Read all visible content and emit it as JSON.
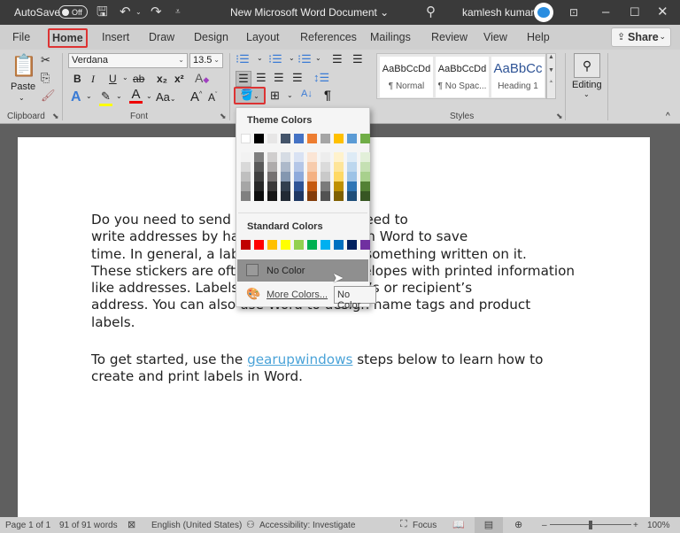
{
  "titlebar": {
    "autosave_label": "AutoSave",
    "autosave_state": "Off",
    "document_title": "New Microsoft Word Document",
    "user_name": "kamlesh kumar",
    "icons": [
      "save-icon",
      "undo-icon",
      "redo-icon",
      "customize-qat-icon",
      "search-icon",
      "ribbon-display-icon",
      "minimize-icon",
      "maximize-icon",
      "close-icon"
    ]
  },
  "tabs": [
    {
      "label": "File"
    },
    {
      "label": "Home",
      "active": true
    },
    {
      "label": "Insert"
    },
    {
      "label": "Draw"
    },
    {
      "label": "Design"
    },
    {
      "label": "Layout"
    },
    {
      "label": "References"
    },
    {
      "label": "Mailings"
    },
    {
      "label": "Review"
    },
    {
      "label": "View"
    },
    {
      "label": "Help"
    }
  ],
  "share_label": "Share",
  "ribbon": {
    "clipboard": {
      "label": "Clipboard",
      "paste": "Paste"
    },
    "font": {
      "label": "Font",
      "font_name": "Verdana",
      "font_size": "13.5",
      "buttons": {
        "bold": "B",
        "italic": "I",
        "underline": "U",
        "strike": "ab",
        "subscript": "x₂",
        "superscript": "x²",
        "case": "Aa",
        "grow": "A",
        "shrink": "A"
      }
    },
    "paragraph": {
      "sort": "A↓",
      "pilcrow": "¶"
    },
    "styles": {
      "label": "Styles",
      "items": [
        {
          "sample": "AaBbCcDd",
          "name": "¶ Normal"
        },
        {
          "sample": "AaBbCcDd",
          "name": "¶ No Spac..."
        },
        {
          "sample": "AaBbCc",
          "name": "Heading 1"
        }
      ]
    },
    "editing": {
      "label": "Editing"
    }
  },
  "shading_menu": {
    "theme_title": "Theme Colors",
    "theme_colors": [
      "#ffffff",
      "#000000",
      "#e7e6e6",
      "#44546a",
      "#4472c4",
      "#ed7d31",
      "#a5a5a5",
      "#ffc000",
      "#5b9bd5",
      "#70ad47"
    ],
    "theme_shades": [
      [
        "#f2f2f2",
        "#d9d9d9",
        "#bfbfbf",
        "#a6a6a6",
        "#808080"
      ],
      [
        "#7f7f7f",
        "#595959",
        "#3f3f3f",
        "#262626",
        "#0d0d0d"
      ],
      [
        "#d0cece",
        "#aeabab",
        "#757171",
        "#3a3838",
        "#171616"
      ],
      [
        "#d6dce4",
        "#adb9ca",
        "#8497b0",
        "#323f4f",
        "#222a35"
      ],
      [
        "#d9e2f3",
        "#b4c6e7",
        "#8eaadb",
        "#2f5496",
        "#1f3864"
      ],
      [
        "#fbe5d5",
        "#f7cbac",
        "#f4b183",
        "#c55a11",
        "#833c0b"
      ],
      [
        "#ededed",
        "#dbdbdb",
        "#c9c9c9",
        "#7b7b7b",
        "#525252"
      ],
      [
        "#fff2cc",
        "#fee599",
        "#ffd965",
        "#bf9000",
        "#7f6000"
      ],
      [
        "#deebf6",
        "#bdd7ee",
        "#9dc3e6",
        "#2e75b5",
        "#1e4e79"
      ],
      [
        "#e2efd9",
        "#c5e0b3",
        "#a8d08d",
        "#538135",
        "#375623"
      ]
    ],
    "standard_title": "Standard Colors",
    "standard_colors": [
      "#c00000",
      "#ff0000",
      "#ffc000",
      "#ffff00",
      "#92d050",
      "#00b050",
      "#00b0f0",
      "#0070c0",
      "#002060",
      "#7030a0"
    ],
    "no_color": "No Color",
    "more_colors": "More Colors..."
  },
  "tooltip": "No Color",
  "document": {
    "para1": "Do you need to send letters? You don’t need to write addresses by hand. Create a label in Word to save time. In general, a label is a sticker with something written on it. These stickers are often attached to envelopes with printed information like addresses. Labels include the sender’s or recipient’s address. You can also use Word to design name tags and product labels.",
    "para1_lines": [
      "Do you need to send letters? You don’t need to",
      "write addresses by hand. Create a label in Word to save",
      "time. In general, a label is a sticker with something written on it.",
      "These stickers are often attached to envelopes with printed information",
      "like addresses. Labels include the sender’s or recipient’s",
      "address. You can also use Word to design name tags and product",
      "labels."
    ],
    "para2_pre": "To get started, use the ",
    "para2_link": "gearupwindows",
    "para2_post": " steps below to learn how to",
    "para2_line2": "create and print labels in Word."
  },
  "status": {
    "page": "Page 1 of 1",
    "words": "91 of 91 words",
    "language": "English (United States)",
    "accessibility": "Accessibility: Investigate",
    "focus": "Focus",
    "zoom": "100%",
    "zoom_percent": 100
  }
}
